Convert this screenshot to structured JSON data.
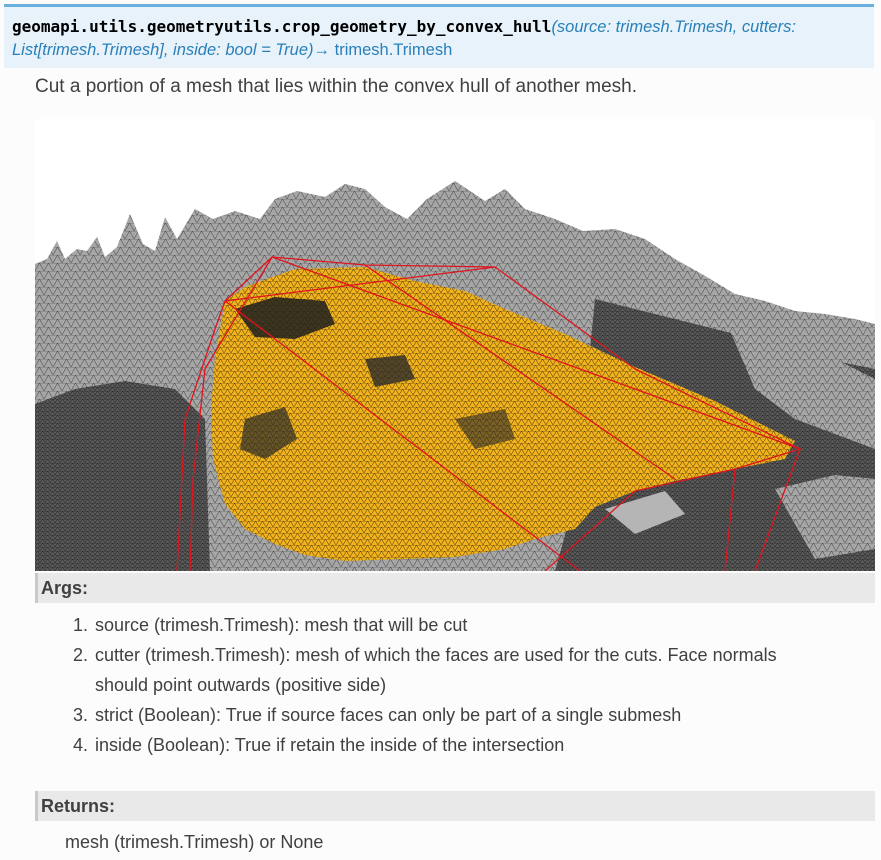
{
  "signature": {
    "name": "geomapi.utils.geometryutils.crop_geometry_by_convex_hull",
    "params_line1": "(source: trimesh.Trimesh, cutters:",
    "params_line2": "List[trimesh.Trimesh], inside: bool = True)",
    "arrow": "→",
    "return_type": "trimesh.Trimesh"
  },
  "summary": "Cut a portion of a mesh that lies within the convex hull of another mesh.",
  "figure": {
    "colors": {
      "mesh_gray": "#9a9a9a",
      "mesh_dark": "#3a3a3a",
      "cut_yellow": "#f2b21c",
      "hull_red": "#e0141e"
    }
  },
  "args": {
    "heading": "Args:",
    "items": [
      {
        "num": "1.",
        "line1": "source (trimesh.Trimesh): mesh that will be cut",
        "line2": ""
      },
      {
        "num": "2.",
        "line1": "cutter (trimesh.Trimesh): mesh of which the faces are used for the cuts. Face normals",
        "line2": "should point outwards (positive side)"
      },
      {
        "num": "3.",
        "line1": "strict (Boolean): True if source faces can only be part of a single submesh",
        "line2": ""
      },
      {
        "num": "4.",
        "line1": "inside (Boolean): True if retain the inside of the intersection",
        "line2": ""
      }
    ]
  },
  "returns": {
    "heading": "Returns:",
    "body": "mesh (trimesh.Trimesh) or None"
  }
}
